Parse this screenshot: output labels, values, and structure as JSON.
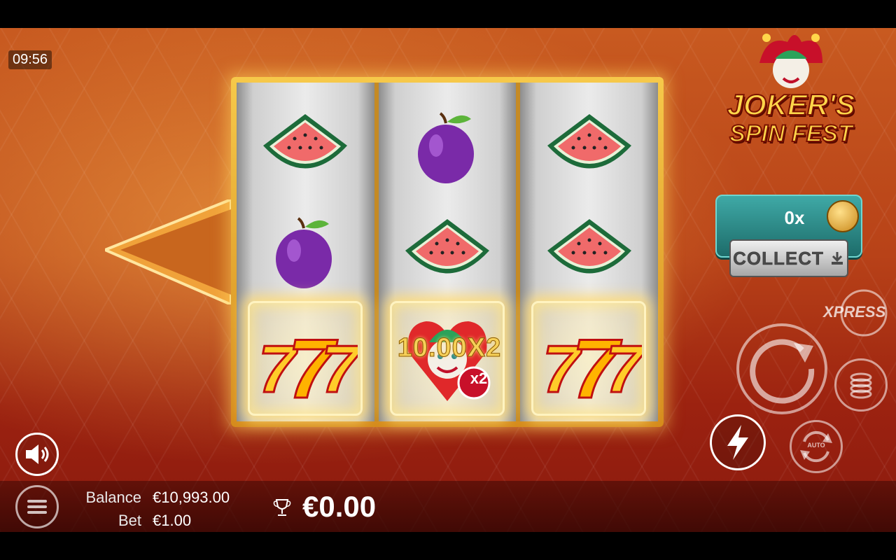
{
  "status": {
    "clock": "09:56"
  },
  "game": {
    "logo_line1": "JOKER'S",
    "logo_line2": "SPIN FEST",
    "reels": [
      [
        "watermark-watermelon",
        "plum",
        "seven"
      ],
      [
        "plum",
        "watermelon",
        "joker-x2"
      ],
      [
        "watermelon",
        "watermelon",
        "seven"
      ]
    ],
    "win_label": "10.00X2",
    "joker_multiplier_badge": "x2"
  },
  "collect": {
    "multiplier": "0x",
    "button_label": "COLLECT"
  },
  "controls": {
    "xpress_label": "XPRESS",
    "auto_label": "AUTO"
  },
  "footer": {
    "balance_label": "Balance",
    "balance_value": "€10,993.00",
    "bet_label": "Bet",
    "bet_value": "€1.00",
    "win_value": "€0.00"
  },
  "colors": {
    "accent_gold": "#f6c94a",
    "collect_teal": "#2a8a87"
  }
}
